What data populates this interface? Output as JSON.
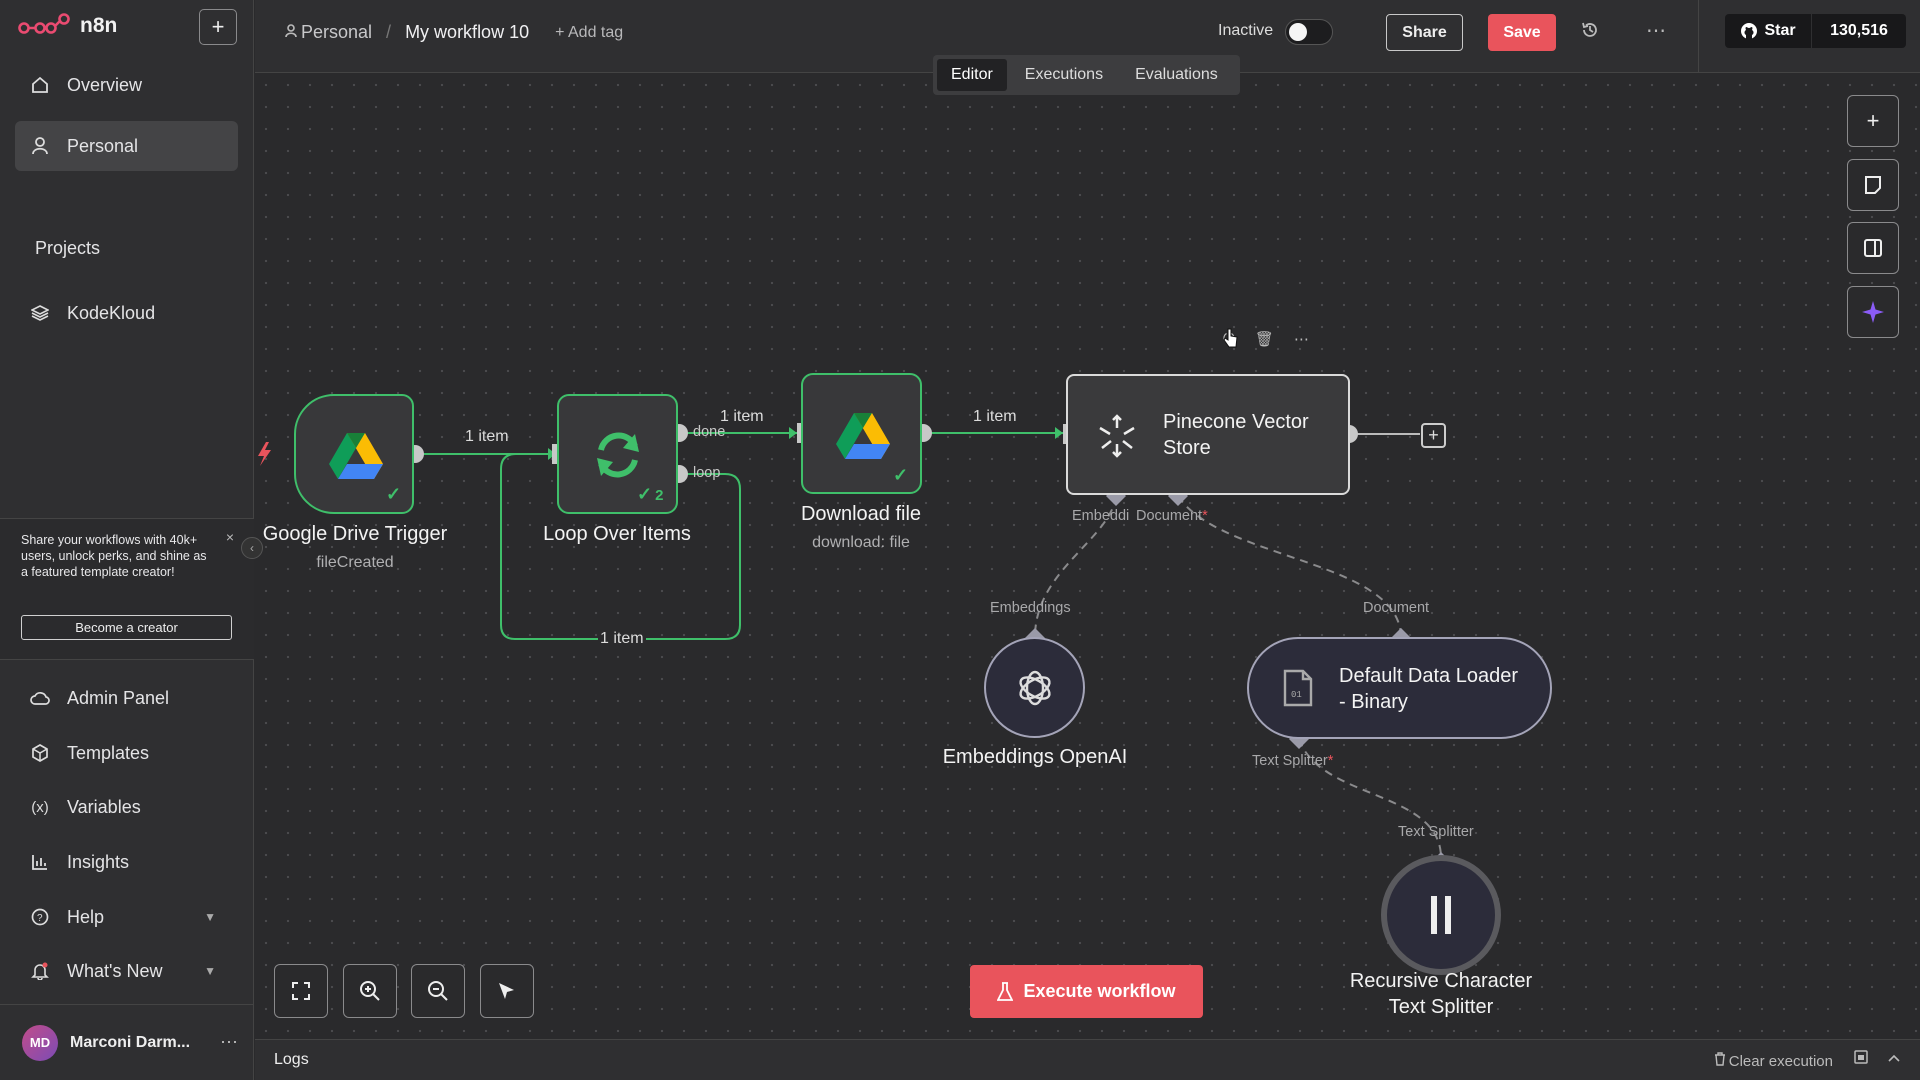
{
  "app": {
    "name": "n8n",
    "accent": "#e9545c",
    "success": "#3fbf6a"
  },
  "sidebar": {
    "overview": "Overview",
    "personal": "Personal",
    "projects_heading": "Projects",
    "project_kodekloud": "KodeKloud",
    "promo": {
      "text": "Share your workflows with 40k+ users, unlock perks, and shine as a featured template creator!",
      "button": "Become a creator"
    },
    "bottom_items": {
      "admin": "Admin Panel",
      "templates": "Templates",
      "variables": "Variables",
      "insights": "Insights",
      "help": "Help",
      "whats_new": "What's New"
    },
    "user": {
      "initials": "MD",
      "name": "Marconi Darm..."
    }
  },
  "header": {
    "project": "Personal",
    "workflow_name": "My workflow 10",
    "add_tag": "+ Add tag",
    "status_label": "Inactive",
    "active": false,
    "share": "Share",
    "save": "Save",
    "github_star": "Star",
    "github_count": "130,516"
  },
  "tabs": [
    "Editor",
    "Executions",
    "Evaluations"
  ],
  "active_tab": "Editor",
  "nodes": {
    "trigger": {
      "title": "Google Drive Trigger",
      "subtitle": "fileCreated"
    },
    "loop": {
      "title": "Loop Over Items",
      "run_count": "2",
      "out_done": "done",
      "out_loop": "loop"
    },
    "download": {
      "title": "Download file",
      "subtitle": "download: file"
    },
    "pinecone": {
      "title_line1": "Pinecone Vector",
      "title_line2": "Store",
      "input_embeddings": "Embeddi",
      "input_document": "Document",
      "required_mark": "*"
    },
    "embeddings": {
      "title": "Embeddings OpenAI",
      "port_label": "Embeddings"
    },
    "loader": {
      "title_line1": "Default Data Loader",
      "title_line2": "- Binary",
      "port_label": "Document",
      "input_splitter": "Text Splitter"
    },
    "splitter": {
      "title_line1": "Recursive Character",
      "title_line2": "Text Splitter",
      "port_label": "Text Splitter"
    }
  },
  "edges": {
    "trigger_to_loop": "1 item",
    "loop_done_to_download": "1 item",
    "download_to_pinecone": "1 item",
    "loop_back": "1 item"
  },
  "canvas": {
    "execute": "Execute workflow"
  },
  "logs": {
    "label": "Logs",
    "clear": "Clear execution"
  }
}
